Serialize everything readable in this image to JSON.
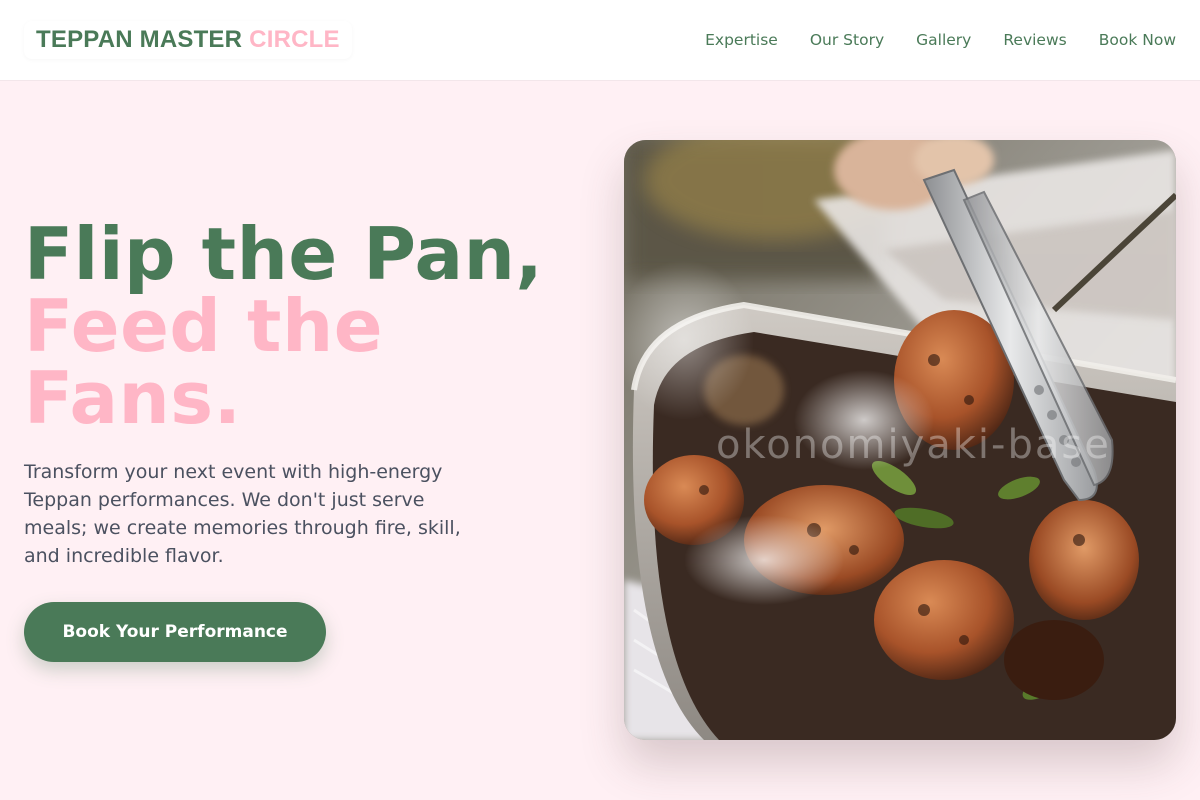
{
  "header": {
    "logo_main": "TEPPAN MASTER",
    "logo_accent": "CIRCLE",
    "nav": [
      {
        "label": "Expertise"
      },
      {
        "label": "Our Story"
      },
      {
        "label": "Gallery"
      },
      {
        "label": "Reviews"
      },
      {
        "label": "Book Now"
      }
    ]
  },
  "hero": {
    "title_line1": "Flip the Pan,",
    "title_line2": "Feed the Fans.",
    "description": "Transform your next event with high-energy Teppan performances. We don't just serve meals; we create memories through fire, skill, and incredible flavor.",
    "cta_label": "Book Your Performance",
    "image_alt": "Tongs lifting grilled chicken from a steaming metal tray",
    "watermark": "okonomiyaki-base"
  },
  "colors": {
    "primary_green": "#4a7a58",
    "accent_pink": "#ffb6c6",
    "page_background": "#fff0f4",
    "body_text": "#4b5160"
  }
}
